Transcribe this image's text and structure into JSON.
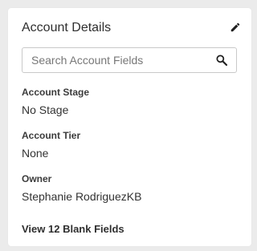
{
  "card": {
    "title": "Account Details",
    "edit_icon": "pencil-icon"
  },
  "search": {
    "placeholder": "Search Account Fields",
    "value": "",
    "icon": "search-icon"
  },
  "fields": [
    {
      "label": "Account Stage",
      "value": "No Stage"
    },
    {
      "label": "Account Tier",
      "value": "None"
    },
    {
      "label": "Owner",
      "value": "Stephanie RodriguezKB"
    }
  ],
  "footer": {
    "view_blank_label": "View 12 Blank Fields"
  }
}
